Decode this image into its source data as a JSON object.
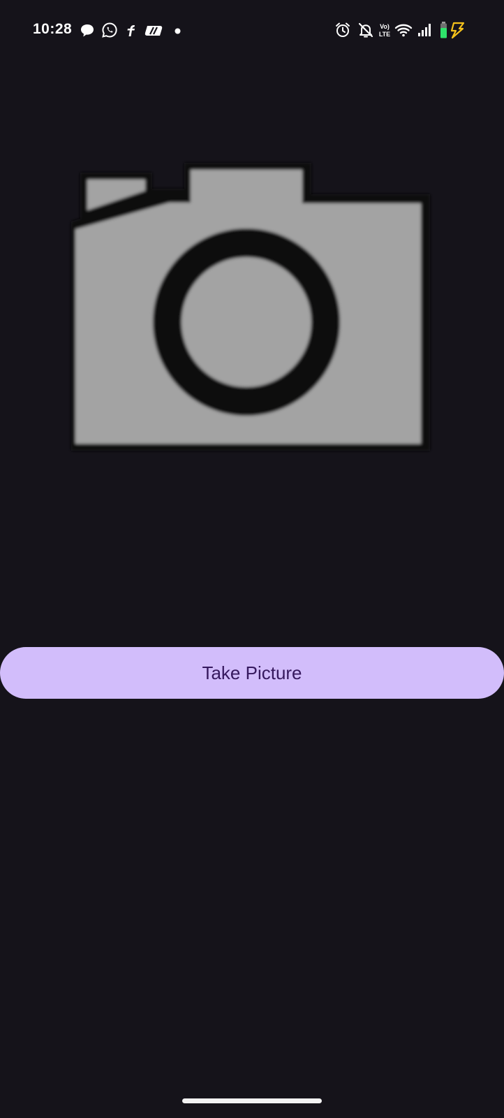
{
  "status_bar": {
    "time": "10:28",
    "left_icons": [
      "chat-bubble-icon",
      "whatsapp-icon",
      "flipkart-icon",
      "payment-app-icon",
      "notification-dot-icon"
    ],
    "right_icons": [
      "alarm-icon",
      "notifications-off-icon",
      "volte-icon",
      "wifi-icon",
      "signal-icon",
      "battery-charging-icon"
    ],
    "volte_text": "Vo)\nLTE"
  },
  "main": {
    "image_icon": "camera-placeholder-icon",
    "take_picture_label": "Take Picture"
  },
  "colors": {
    "background": "#15131a",
    "button_background": "#d2bdfb",
    "button_text": "#36195e",
    "camera_body": "#a3a3a3",
    "camera_outline": "#0c0b10",
    "battery_green": "#2ee36b",
    "charging_bolt": "#f5c21b"
  }
}
